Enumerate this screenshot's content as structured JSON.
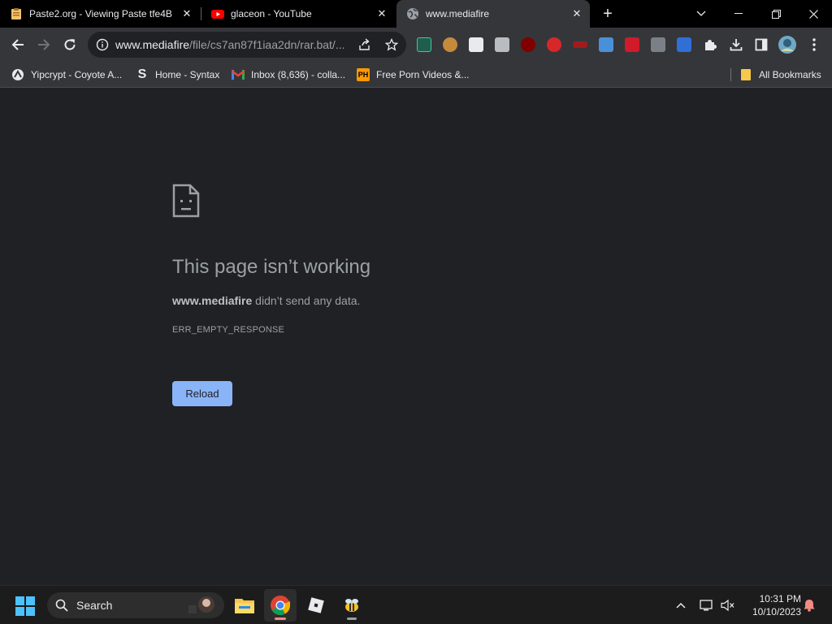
{
  "tabs": [
    {
      "title": "Paste2.org - Viewing Paste tfe4B",
      "icon": "clipboard-icon"
    },
    {
      "title": "glaceon - YouTube",
      "icon": "youtube-icon"
    },
    {
      "title": "www.mediafire",
      "icon": "globe-icon",
      "active": true
    }
  ],
  "new_tab_label": "+",
  "window": {
    "minimize": "minimize-icon",
    "restore": "restore-icon",
    "close": "close-icon"
  },
  "omnibox": {
    "host": "www.mediafire",
    "path": "/file/cs7an87f1iaa2dn/rar.bat/..."
  },
  "bookmarks": [
    {
      "label": "Yipcrypt - Coyote A...",
      "icon": "yipcrypt-icon"
    },
    {
      "label": "Home - Syntax",
      "icon": "syntax-icon",
      "glyph": "S"
    },
    {
      "label": "Inbox (8,636) - colla...",
      "icon": "gmail-icon"
    },
    {
      "label": "Free Porn Videos &...",
      "icon": "ph-icon",
      "glyph": "PH"
    }
  ],
  "all_bookmarks": "All Bookmarks",
  "error": {
    "title": "This page isn’t working",
    "host": "www.mediafire",
    "desc_rest": " didn’t send any data.",
    "code": "ERR_EMPTY_RESPONSE",
    "reload": "Reload"
  },
  "taskbar": {
    "search": "Search",
    "time": "10:31 PM",
    "date": "10/10/2023"
  },
  "colors": {
    "accent": "#8ab4f8",
    "background": "#202124",
    "toolbar": "#35363a"
  }
}
